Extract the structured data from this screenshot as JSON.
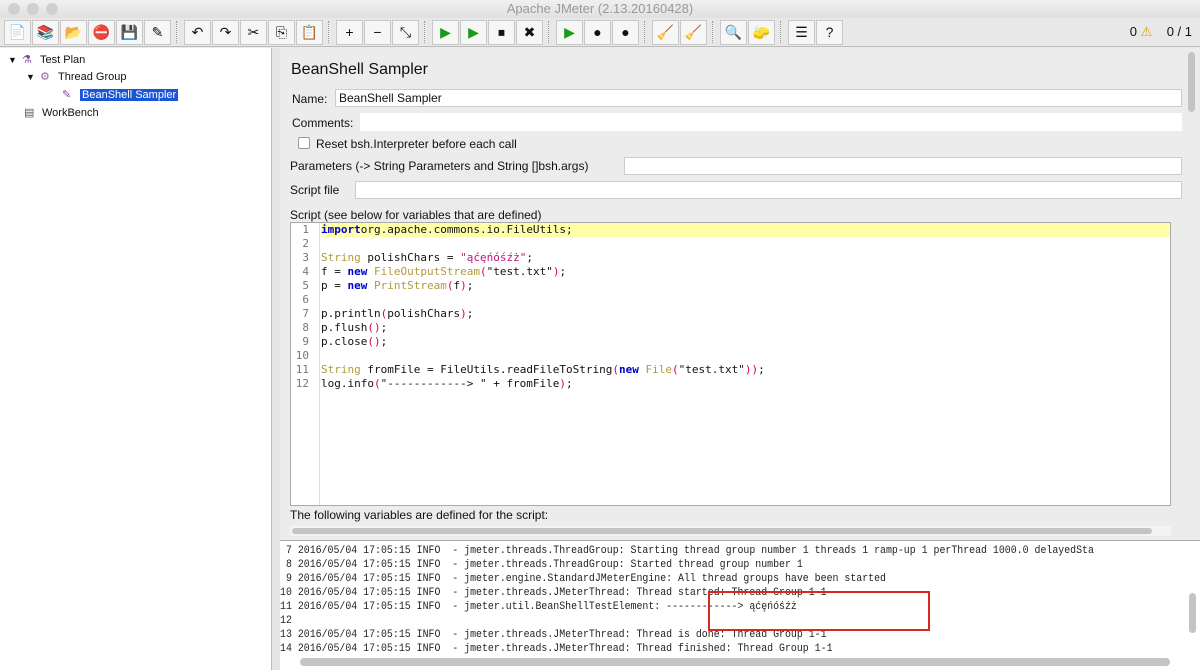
{
  "window": {
    "title": "Apache JMeter (2.13.20160428)"
  },
  "toolbar": {
    "buttons": [
      "new",
      "templates",
      "open",
      "close",
      "save",
      "save-as",
      "undo",
      "redo",
      "cut",
      "copy",
      "paste",
      "expand",
      "collapse",
      "toggle",
      "start",
      "start-no-pauses",
      "stop",
      "shutdown",
      "remote-start-all",
      "remote-stop-all",
      "remote-shutdown-all",
      "clear",
      "clear-all",
      "search",
      "reset-search",
      "function-helper",
      "help"
    ],
    "icons": [
      "📄",
      "📚",
      "📂",
      "⛔",
      "💾",
      "✎",
      "↶",
      "↷",
      "✂",
      "⎘",
      "📋",
      "+",
      "−",
      "⤡",
      "▶",
      "▶",
      "⏹",
      "✖",
      "▶",
      "●",
      "●",
      "🧹",
      "🧹",
      "🔍",
      "🧽",
      "☰",
      "?"
    ],
    "error_count": "0",
    "warning_icon": "warning-icon",
    "threads": "0 / 1"
  },
  "tree": {
    "items": [
      {
        "label": "Test Plan"
      },
      {
        "label": "Thread Group"
      },
      {
        "label": "BeanShell Sampler"
      },
      {
        "label": "WorkBench"
      }
    ]
  },
  "sampler": {
    "title": "BeanShell Sampler",
    "name_label": "Name:",
    "name_value": "BeanShell Sampler",
    "comments_label": "Comments:",
    "reset_label": "Reset bsh.Interpreter before each call",
    "reset_checked": false,
    "parameters_label": "Parameters (-> String Parameters and String []bsh.args)",
    "parameters_value": "",
    "script_file_label": "Script file",
    "script_file_value": "",
    "script_label": "Script (see below for variables that are defined)",
    "footer": "The following variables are defined for the script:"
  },
  "script": {
    "line_numbers": [
      "1",
      "2",
      "3",
      "4",
      "5",
      "6",
      "7",
      "8",
      "9",
      "10",
      "11",
      "12"
    ],
    "lines": [
      [
        [
          "kw",
          "import"
        ],
        [
          "",
          "org.apache.commons.io.FileUtils;"
        ]
      ],
      [],
      [
        [
          "ty",
          "String"
        ],
        [
          "",
          " polishChars = "
        ],
        [
          "st",
          "\"ąćęńóśźż\""
        ],
        [
          "",
          ";"
        ]
      ],
      [
        [
          "",
          "f = "
        ],
        [
          "kw",
          "new"
        ],
        [
          "ty",
          " FileOutputStream"
        ],
        [
          "pn",
          "("
        ],
        [
          "",
          "\"test.txt\""
        ],
        [
          "pn",
          ")"
        ],
        [
          "",
          ";"
        ]
      ],
      [
        [
          "",
          "p = "
        ],
        [
          "kw",
          "new"
        ],
        [
          "ty",
          " PrintStream"
        ],
        [
          "pn",
          "("
        ],
        [
          "",
          "f"
        ],
        [
          "pn",
          ")"
        ],
        [
          "",
          ";"
        ]
      ],
      [],
      [
        [
          "",
          "p.println"
        ],
        [
          "pn",
          "("
        ],
        [
          "",
          "polishChars"
        ],
        [
          "pn",
          ")"
        ],
        [
          "",
          ";"
        ]
      ],
      [
        [
          "",
          "p.flush"
        ],
        [
          "pn",
          "()"
        ],
        [
          "",
          ";"
        ]
      ],
      [
        [
          "",
          "p.close"
        ],
        [
          "pn",
          "()"
        ],
        [
          "",
          ";"
        ]
      ],
      [],
      [
        [
          "ty",
          "String"
        ],
        [
          "",
          " fromFile = FileUtils.readFileToString"
        ],
        [
          "pn",
          "("
        ],
        [
          "kw",
          "new"
        ],
        [
          "ty",
          " File"
        ],
        [
          "pn",
          "("
        ],
        [
          "",
          "\"test.txt\""
        ],
        [
          "pn",
          "))"
        ],
        [
          "",
          ";"
        ]
      ],
      [
        [
          "",
          "log.info"
        ],
        [
          "pn",
          "("
        ],
        [
          "",
          "\"------------> \" + fromFile"
        ],
        [
          "pn",
          ")"
        ],
        [
          "",
          ";"
        ]
      ]
    ]
  },
  "log": {
    "lines": [
      " 7 2016/05/04 17:05:15 INFO  - jmeter.threads.ThreadGroup: Starting thread group number 1 threads 1 ramp-up 1 perThread 1000.0 delayedSta",
      " 8 2016/05/04 17:05:15 INFO  - jmeter.threads.ThreadGroup: Started thread group number 1",
      " 9 2016/05/04 17:05:15 INFO  - jmeter.engine.StandardJMeterEngine: All thread groups have been started",
      "10 2016/05/04 17:05:15 INFO  - jmeter.threads.JMeterThread: Thread started: Thread Group 1-1",
      "11 2016/05/04 17:05:15 INFO  - jmeter.util.BeanShellTestElement: ------------> ąćęńóśźż",
      "12",
      "13 2016/05/04 17:05:15 INFO  - jmeter.threads.JMeterThread: Thread is done: Thread Group 1-1",
      "14 2016/05/04 17:05:15 INFO  - jmeter.threads.JMeterThread: Thread finished: Thread Group 1-1"
    ],
    "highlight_color": "#d52b1e"
  }
}
